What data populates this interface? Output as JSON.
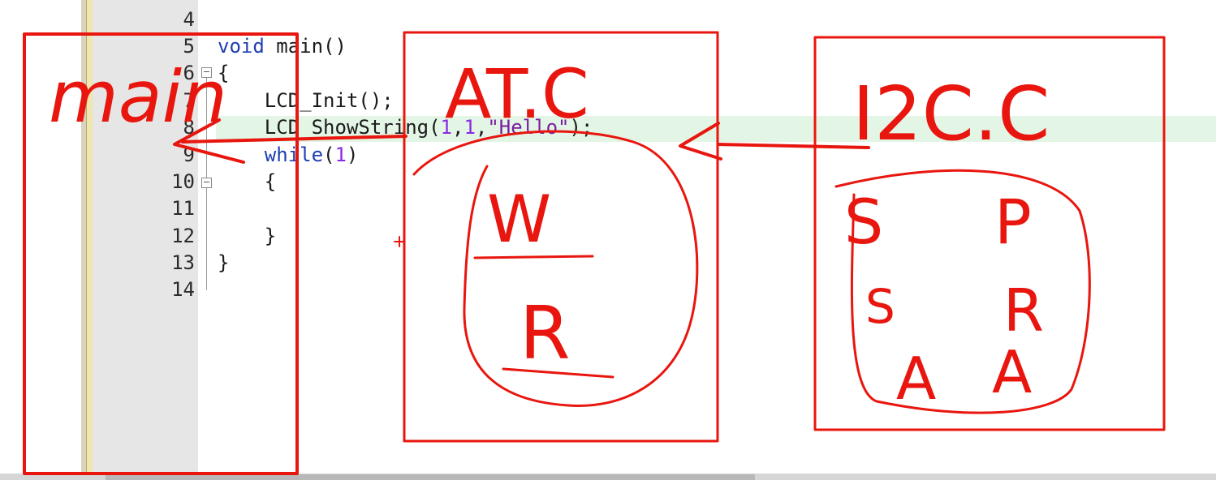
{
  "editor": {
    "lines": [
      {
        "num": "4",
        "parts": []
      },
      {
        "num": "5",
        "parts": [
          {
            "t": "void",
            "c": "kw"
          },
          {
            "t": " main()",
            "c": ""
          }
        ]
      },
      {
        "num": "6",
        "parts": [
          {
            "t": "{",
            "c": ""
          }
        ]
      },
      {
        "num": "7",
        "parts": [
          {
            "t": "    LCD_Init();",
            "c": ""
          }
        ]
      },
      {
        "num": "8",
        "parts": [
          {
            "t": "    LCD_ShowString(",
            "c": ""
          },
          {
            "t": "1",
            "c": "num"
          },
          {
            "t": ",",
            "c": ""
          },
          {
            "t": "1",
            "c": "num"
          },
          {
            "t": ",",
            "c": ""
          },
          {
            "t": "\"Hello\"",
            "c": "str"
          },
          {
            "t": ");",
            "c": ""
          }
        ]
      },
      {
        "num": "9",
        "parts": [
          {
            "t": "    ",
            "c": ""
          },
          {
            "t": "while",
            "c": "kw"
          },
          {
            "t": "(",
            "c": ""
          },
          {
            "t": "1",
            "c": "num"
          },
          {
            "t": ")",
            "c": ""
          }
        ]
      },
      {
        "num": "10",
        "parts": [
          {
            "t": "    {",
            "c": ""
          }
        ]
      },
      {
        "num": "11",
        "parts": []
      },
      {
        "num": "12",
        "parts": [
          {
            "t": "    }",
            "c": ""
          }
        ]
      },
      {
        "num": "13",
        "parts": [
          {
            "t": "}",
            "c": ""
          }
        ]
      },
      {
        "num": "14",
        "parts": []
      }
    ]
  },
  "annotations": {
    "main_label": "main",
    "at_c_label": "AT.C",
    "i2c_c_label": "I2C.C",
    "w_label": "W",
    "r_label": "R",
    "s_label_1": "S",
    "p_label": "P",
    "s_label_2": "S",
    "r_label_2": "R",
    "a_label_1": "A",
    "a_label_2": "A",
    "ink_color": "#e8160e"
  }
}
